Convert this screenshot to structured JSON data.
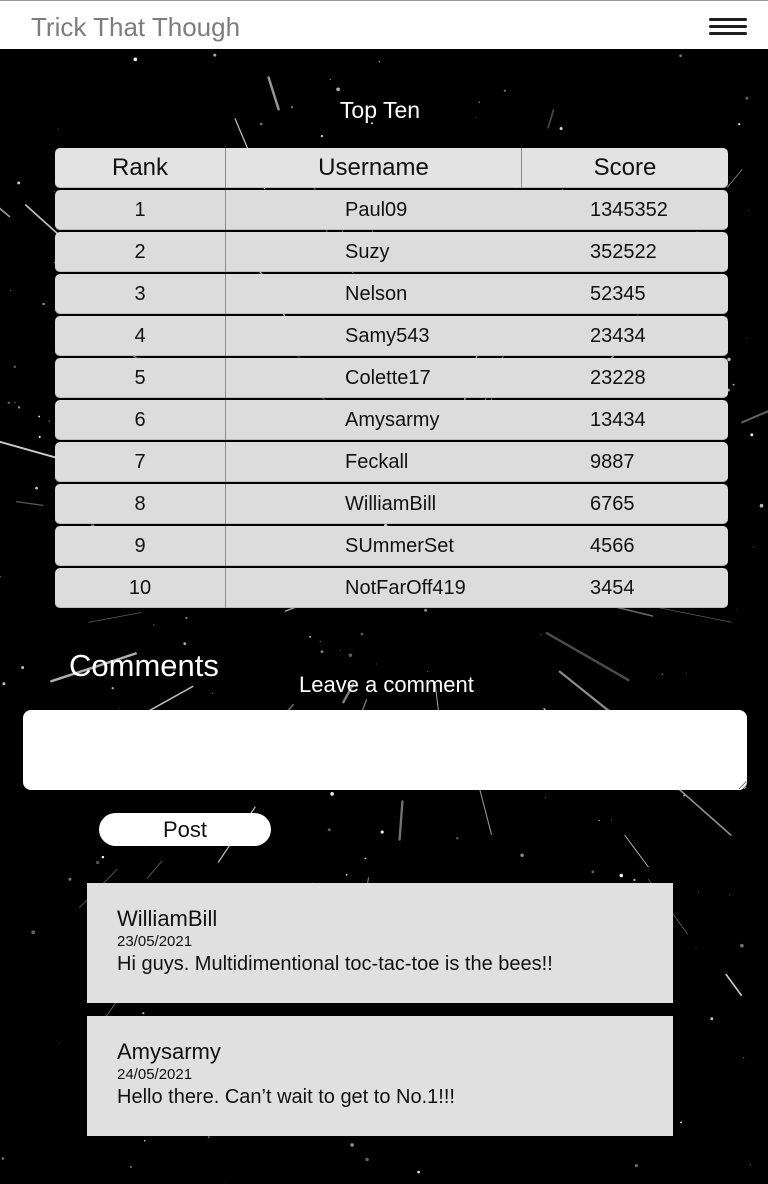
{
  "app": {
    "title": "Trick That Though"
  },
  "leaderboard": {
    "title": "Top Ten",
    "columns": [
      "Rank",
      "Username",
      "Score"
    ],
    "rows": [
      {
        "rank": "1",
        "username": "Paul09",
        "score": "1345352"
      },
      {
        "rank": "2",
        "username": "Suzy",
        "score": "352522"
      },
      {
        "rank": "3",
        "username": "Nelson",
        "score": "52345"
      },
      {
        "rank": "4",
        "username": "Samy543",
        "score": "23434"
      },
      {
        "rank": "5",
        "username": "Colette17",
        "score": "23228"
      },
      {
        "rank": "6",
        "username": "Amysarmy",
        "score": "13434"
      },
      {
        "rank": "7",
        "username": "Feckall",
        "score": "9887"
      },
      {
        "rank": "8",
        "username": "WilliamBill",
        "score": "6765"
      },
      {
        "rank": "9",
        "username": "SUmmerSet",
        "score": "4566"
      },
      {
        "rank": "10",
        "username": "NotFarOff419",
        "score": "3454"
      }
    ]
  },
  "comments": {
    "title": "Comments",
    "leave_label": "Leave a comment",
    "input_value": "",
    "post_label": "Post",
    "items": [
      {
        "author": "WilliamBill",
        "date": "23/05/2021",
        "text": "Hi guys. Multidimentional toc-tac-toe is the bees!!"
      },
      {
        "author": "Amysarmy",
        "date": "24/05/2021",
        "text": "Hello there. Can’t wait to get to No.1!!!"
      }
    ]
  },
  "icons": {
    "menu": "hamburger-menu-icon"
  },
  "colors": {
    "background": "#000000",
    "card": "#e0e0e0",
    "title_gray": "#7d7d7d"
  }
}
